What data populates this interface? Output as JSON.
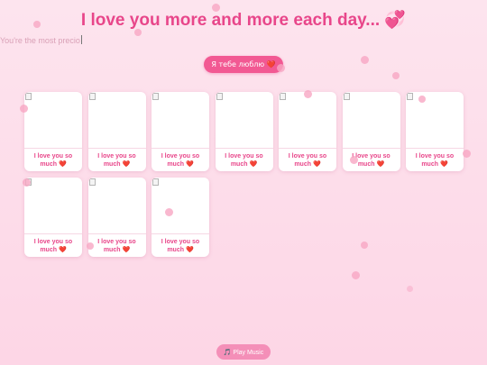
{
  "title": "I love you more and more each day...",
  "title_icon": "💞",
  "typewriter_text": "You're the most precio",
  "love_button_label": "Я тебе люблю ❤️",
  "cards": [
    {
      "caption": "I love you so much ❤️"
    },
    {
      "caption": "I love you so much ❤️"
    },
    {
      "caption": "I love you so much ❤️"
    },
    {
      "caption": "I love you so much ❤️"
    },
    {
      "caption": "I love you so much ❤️"
    },
    {
      "caption": "I love you so much ❤️"
    },
    {
      "caption": "I love you so much ❤️"
    },
    {
      "caption": "I love you so much ❤️"
    },
    {
      "caption": "I love you so much ❤️"
    },
    {
      "caption": "I love you so much ❤️"
    }
  ],
  "music_button_label": "🎵 Play Music",
  "colors": {
    "accent": "#e8468a",
    "button": "#f25993",
    "background": "#fde4ee"
  }
}
